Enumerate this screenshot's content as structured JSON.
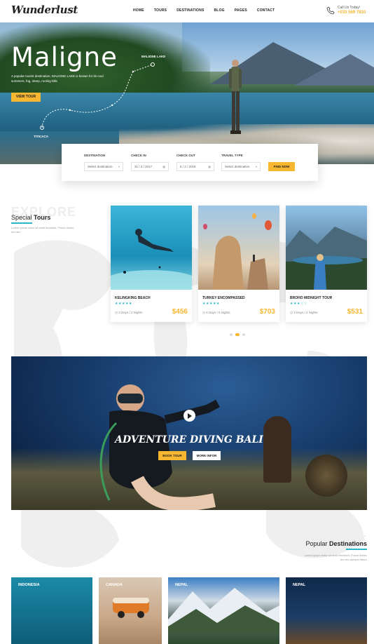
{
  "header": {
    "logo": "Wunderlust",
    "nav": [
      "HOME",
      "TOURS",
      "DESTINATIONS",
      "BLOG",
      "PAGES",
      "CONTACT"
    ],
    "call_label": "Call Us Today!",
    "call_number": "+033 569 7810",
    "accent": "#f7b731"
  },
  "hero": {
    "title": "Maligne",
    "description": "A popular tourist destination, MALIGNE LAKE is known for its cool summers, fog, steep, rooling hills",
    "button": "VIEW TOUR",
    "pin_top": "MALIGNE LAKE",
    "pin_bottom": "TITICACA"
  },
  "search": {
    "labels": [
      "DESTINATION",
      "CHECK IN",
      "CHECK OUT",
      "TRAVEL TYPE"
    ],
    "destination": "Select destination",
    "check_in": "31 / 4 / 2017",
    "check_out": "6 / 2 / 2018",
    "travel_type": "Select destination",
    "button": "FIND NOW"
  },
  "special": {
    "ghost": "EXPLORE",
    "title_light": "Special",
    "title_bold": "Tours",
    "description": "Lorem ipsum dolor sit amet tincidunt. Fusce donec leo nec",
    "cards": [
      {
        "name": "KELINGKING BEACH",
        "stars": "★★★★★",
        "duration": "3 Days / 2 Nights",
        "price": "$456"
      },
      {
        "name": "TURKEY ENCOMPASSED",
        "stars": "★★★★★",
        "duration": "6 Days / 5 Nights",
        "price": "$703"
      },
      {
        "name": "BROHO MIDNIGHT TOUR",
        "stars": "★★★☆☆",
        "duration": "3 Days / 2 Nights",
        "price": "$531"
      }
    ]
  },
  "diving": {
    "title": "ADVENTURE DIVING BALI",
    "book": "BOOK TOUR",
    "more": "MORE INFOR"
  },
  "popular": {
    "ghost": "ADVENTURE",
    "title_light": "Popular",
    "title_bold": "Destinations",
    "description": "Lorem ipsum dolor sit amet tincidunt. Fusce donec leo nec semper libero",
    "items": [
      "INDONESIA",
      "CANADA",
      "NEPAL",
      "NEPAL"
    ]
  }
}
